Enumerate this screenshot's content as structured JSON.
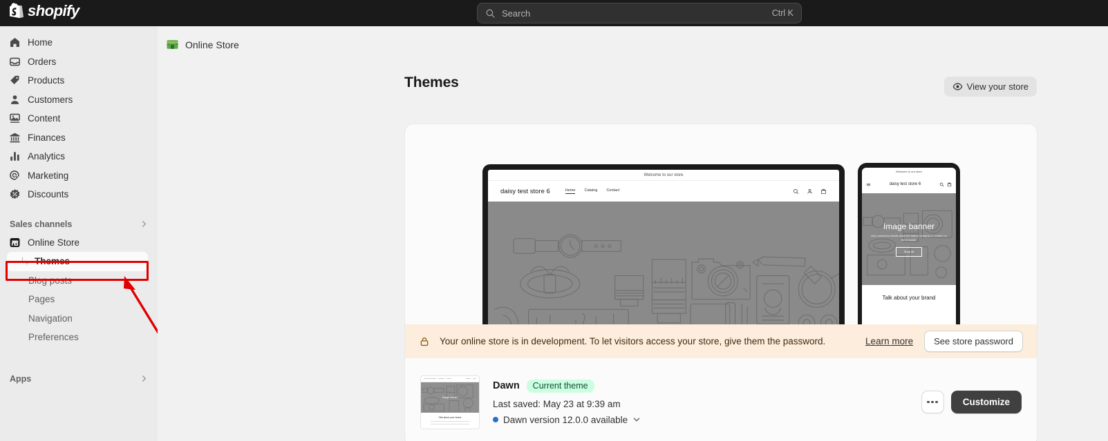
{
  "topbar": {
    "brand": "shopify",
    "brand_icon": "shopify-bag-icon",
    "search": {
      "placeholder": "Search",
      "shortcut": "Ctrl K",
      "icon": "search-icon"
    }
  },
  "sidebar": {
    "items": [
      {
        "label": "Home",
        "icon": "home-icon"
      },
      {
        "label": "Orders",
        "icon": "orders-inbox-icon"
      },
      {
        "label": "Products",
        "icon": "product-tag-icon"
      },
      {
        "label": "Customers",
        "icon": "person-icon"
      },
      {
        "label": "Content",
        "icon": "content-image-icon"
      },
      {
        "label": "Finances",
        "icon": "bank-icon"
      },
      {
        "label": "Analytics",
        "icon": "bar-chart-icon"
      },
      {
        "label": "Marketing",
        "icon": "marketing-target-icon"
      },
      {
        "label": "Discounts",
        "icon": "discount-percent-icon"
      }
    ],
    "sales_channels": {
      "label": "Sales channels",
      "chevron": "chevron-right-icon"
    },
    "online_store": {
      "label": "Online Store",
      "icon": "storefront-icon"
    },
    "online_store_children": [
      {
        "label": "Themes",
        "active": true,
        "icon": "subnav-arrow-icon"
      },
      {
        "label": "Blog posts",
        "active": false
      },
      {
        "label": "Pages",
        "active": false
      },
      {
        "label": "Navigation",
        "active": false
      },
      {
        "label": "Preferences",
        "active": false
      }
    ],
    "apps": {
      "label": "Apps",
      "chevron": "chevron-right-icon"
    }
  },
  "annotation": {
    "highlight_color": "#e00000",
    "target": "Themes",
    "shape": "red-rectangle-with-arrow"
  },
  "main": {
    "breadcrumb": {
      "label": "Online Store",
      "icon": "green-storefront-icon"
    },
    "page_title": "Themes",
    "view_store_button": {
      "label": "View your store",
      "icon": "eye-icon"
    },
    "preview": {
      "desktop": {
        "announcement": "Welcome to our store",
        "brand": "daisy test store 6",
        "nav": [
          "Home",
          "Catalog",
          "Contact"
        ],
        "active_nav": "Home",
        "header_icons": [
          "search-icon",
          "account-icon",
          "cart-icon"
        ]
      },
      "mobile": {
        "announcement": "Welcome to our store",
        "brand": "daisy test store 6",
        "menu_icon": "hamburger-menu-icon",
        "header_icons": [
          "search-icon",
          "cart-icon"
        ],
        "banner_heading": "Image banner",
        "banner_subtext": "Give customers details about the banner image(s) or content on the template.",
        "banner_button": "Shop all",
        "section_heading": "Talk about your brand"
      }
    },
    "dev_banner": {
      "icon": "lock-icon",
      "message": "Your online store is in development. To let visitors access your store, give them the password.",
      "learn_more": "Learn more",
      "password_button": "See store password",
      "background": "#fdeddc"
    },
    "theme": {
      "name": "Dawn",
      "badge": "Current theme",
      "badge_color": "#cdfee1",
      "last_saved": "Last saved: May 23 at 9:39 am",
      "version_note": "Dawn version 12.0.0 available",
      "version_dot_color": "#2c6ecb",
      "version_chevron": "chevron-down-icon",
      "more_button": "more-actions-icon",
      "customize_button": "Customize",
      "thumbnail": {
        "banner_text": "Image banner",
        "caption": "Talk about your brand"
      }
    }
  }
}
